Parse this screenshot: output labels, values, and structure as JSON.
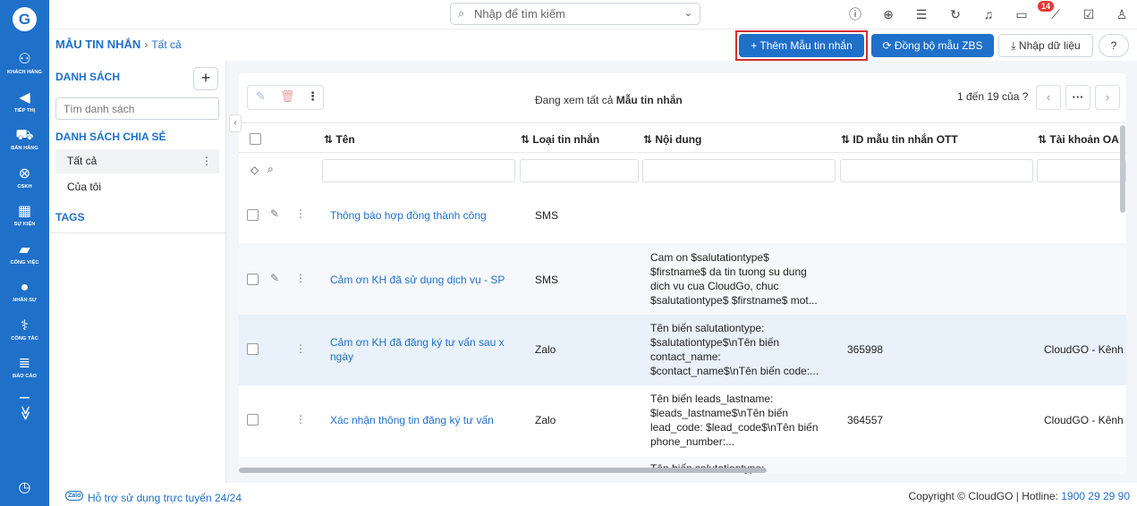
{
  "nav": {
    "logo": "G",
    "items": [
      {
        "label": "KHÁCH HÀNG",
        "icon": "customers-icon",
        "glyph": "⚇"
      },
      {
        "label": "TIẾP THỊ",
        "icon": "megaphone-icon",
        "glyph": "◀"
      },
      {
        "label": "BÁN HÀNG",
        "icon": "cart-icon",
        "glyph": "⛟"
      },
      {
        "label": "CSKH",
        "icon": "support-icon",
        "glyph": "⊗"
      },
      {
        "label": "SỰ KIỆN",
        "icon": "calendar-icon",
        "glyph": "▦"
      },
      {
        "label": "CÔNG VIỆC",
        "icon": "briefcase-icon",
        "glyph": "▰"
      },
      {
        "label": "NHÂN SỰ",
        "icon": "person-icon",
        "glyph": "●"
      },
      {
        "label": "CÔNG TÁC",
        "icon": "org-chart-icon",
        "glyph": "⚕"
      },
      {
        "label": "BÁO CÁO",
        "icon": "report-icon",
        "glyph": "≣"
      }
    ],
    "more_glyph": "≫",
    "clock_glyph": "◷"
  },
  "topbar": {
    "search_placeholder": "Nhập để tìm kiếm",
    "notification_count": "14"
  },
  "breadcrumb": {
    "module": "MẪU TIN NHẮN",
    "separator": "›",
    "view": "Tất cả"
  },
  "actions": {
    "add": "+ Thêm Mẫu tin nhắn",
    "sync": "⟳ Đồng bộ mẫu ZBS",
    "import": "⤓ Nhập dữ liệu",
    "help": "?"
  },
  "sidebar": {
    "list_title": "DANH SÁCH",
    "add": "+",
    "search_placeholder": "Tìm danh sách",
    "shared_title": "DANH SÁCH CHIA SẺ",
    "items": [
      {
        "label": "Tất cả",
        "menu": "⋮"
      },
      {
        "label": "Của tôi"
      }
    ],
    "tags_title": "TAGS"
  },
  "table": {
    "viewing_prefix": "Đang xem tất cả",
    "viewing_module": "Mẫu tin nhắn",
    "pagination": "1 đến 19 của ?",
    "columns": [
      {
        "label": "⇅ Tên"
      },
      {
        "label": "⇅ Loại tin nhắn"
      },
      {
        "label": "⇅ Nội dung"
      },
      {
        "label": "⇅ ID mẫu tin nhắn OTT"
      },
      {
        "label": "⇅ Tài khoản OA"
      }
    ],
    "rows": [
      {
        "name": "Thông báo hợp đồng thành công",
        "type": "SMS",
        "content": [],
        "id": "",
        "account": ""
      },
      {
        "name": "Cảm ơn KH đã sử dụng dịch vụ - SP",
        "type": "SMS",
        "content": [
          "Cam on $salutationtype$",
          "$firstname$ da tin tuong su dung",
          "dich vu cua CloudGo, chuc",
          "$salutationtype$ $firstname$ mot..."
        ],
        "id": "",
        "account": ""
      },
      {
        "name": "Cảm ơn KH đã đăng ký tư vấn sau x",
        "name2": "ngày",
        "type": "Zalo",
        "content": [
          "Tên biến salutationtype:",
          "$salutationtype$\\nTên biến",
          "contact_name:",
          "$contact_name$\\nTên biến code:..."
        ],
        "id": "365998",
        "account": "CloudGO - Kênh"
      },
      {
        "name": "Xác nhận thông tin đăng ký tư vấn",
        "type": "Zalo",
        "content": [
          "Tên biến leads_lastname:",
          "$leads_lastname$\\nTên biến",
          "lead_code: $lead_code$\\nTên biến",
          "phone_number:..."
        ],
        "id": "364557",
        "account": "CloudGO - Kênh"
      },
      {
        "name": "",
        "type": "",
        "content": [
          "Tên biến salutationtype:"
        ],
        "id": "",
        "account": ""
      }
    ]
  },
  "footer": {
    "zalo": "Zalo",
    "support": "Hỗ trợ sử dụng trực tuyến 24/24",
    "copyright": "Copyright © CloudGO | Hotline:",
    "hotline": "1900 29 29 90"
  },
  "colors": {
    "brand": "#1f70c9",
    "highlight": "#d32f2f"
  }
}
